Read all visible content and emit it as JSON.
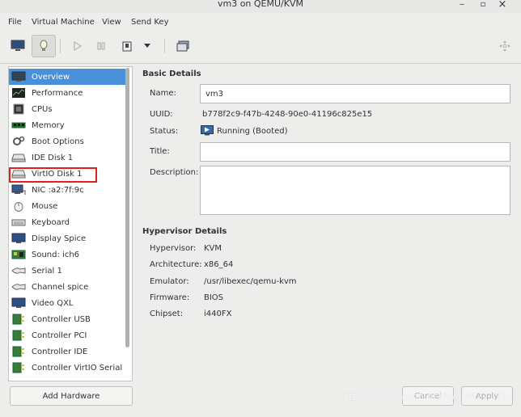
{
  "window": {
    "title": "vm3 on QEMU/KVM",
    "min_glyph": "‒",
    "max_glyph": "▫",
    "close_glyph": "×"
  },
  "menu": [
    "File",
    "Virtual Machine",
    "View",
    "Send Key"
  ],
  "sidebar": {
    "items": [
      {
        "label": "Overview",
        "icon": "overview-icon"
      },
      {
        "label": "Performance",
        "icon": "performance-icon"
      },
      {
        "label": "CPUs",
        "icon": "cpu-icon"
      },
      {
        "label": "Memory",
        "icon": "memory-icon"
      },
      {
        "label": "Boot Options",
        "icon": "boot-options-icon"
      },
      {
        "label": "IDE Disk 1",
        "icon": "disk-icon"
      },
      {
        "label": "VirtIO Disk 1",
        "icon": "disk-icon"
      },
      {
        "label": "NIC :a2:7f:9c",
        "icon": "nic-icon"
      },
      {
        "label": "Mouse",
        "icon": "mouse-icon"
      },
      {
        "label": "Keyboard",
        "icon": "keyboard-icon"
      },
      {
        "label": "Display Spice",
        "icon": "display-icon"
      },
      {
        "label": "Sound: ich6",
        "icon": "sound-icon"
      },
      {
        "label": "Serial 1",
        "icon": "serial-icon"
      },
      {
        "label": "Channel spice",
        "icon": "channel-icon"
      },
      {
        "label": "Video QXL",
        "icon": "video-icon"
      },
      {
        "label": "Controller USB",
        "icon": "controller-icon"
      },
      {
        "label": "Controller PCI",
        "icon": "controller-icon"
      },
      {
        "label": "Controller IDE",
        "icon": "controller-icon"
      },
      {
        "label": "Controller VirtIO Serial",
        "icon": "controller-icon"
      }
    ],
    "add_hardware": "Add Hardware"
  },
  "basic": {
    "heading": "Basic Details",
    "name_label": "Name:",
    "name_value": "vm3",
    "uuid_label": "UUID:",
    "uuid_value": "b778f2c9-f47b-4248-90e0-41196c825e15",
    "status_label": "Status:",
    "status_value": "Running (Booted)",
    "title_label": "Title:",
    "title_value": "",
    "desc_label": "Description:",
    "desc_value": ""
  },
  "hypervisor": {
    "heading": "Hypervisor Details",
    "hv_label": "Hypervisor:",
    "hv_value": "KVM",
    "arch_label": "Architecture:",
    "arch_value": "x86_64",
    "emu_label": "Emulator:",
    "emu_value": "/usr/libexec/qemu-kvm",
    "fw_label": "Firmware:",
    "fw_value": "BIOS",
    "chip_label": "Chipset:",
    "chip_value": "i440FX"
  },
  "footer": {
    "cancel": "Cancel",
    "apply": "Apply"
  },
  "watermark": "https://blog.csdn.net/qq_44221394",
  "colors": {
    "selected": "#4a90d9",
    "highlight": "#e0201c"
  }
}
